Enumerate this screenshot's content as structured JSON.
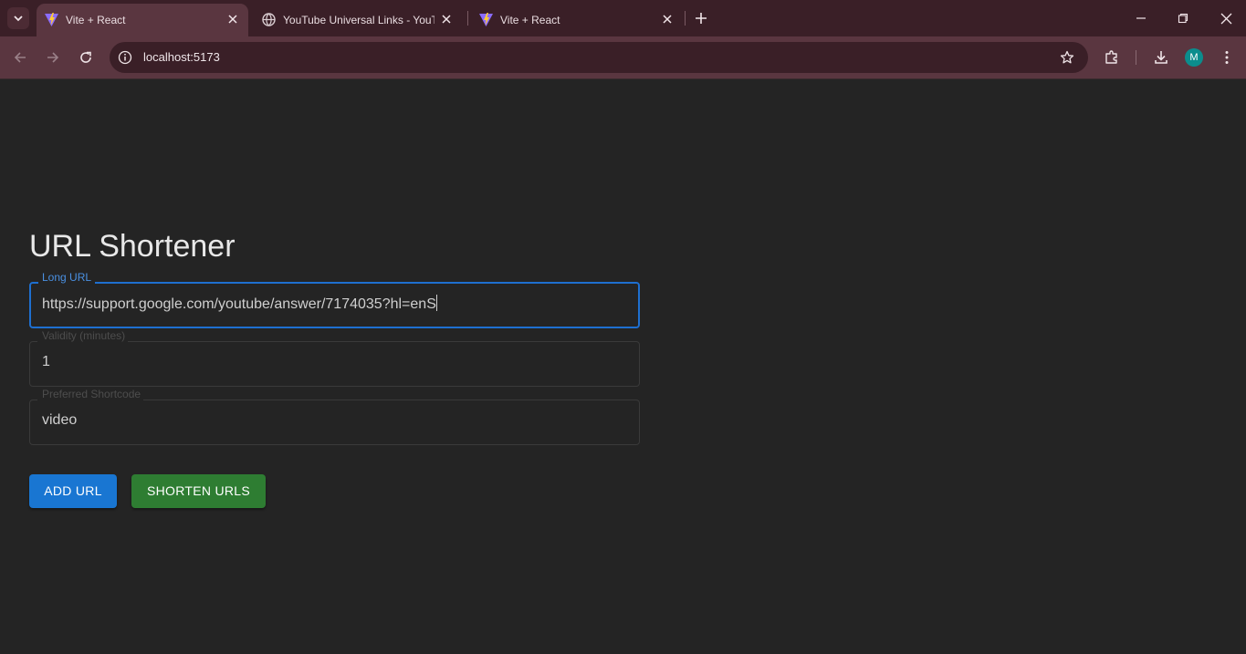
{
  "browser": {
    "tabs": [
      {
        "title": "Vite + React",
        "active": true,
        "favicon": "vite-icon"
      },
      {
        "title": "YouTube Universal Links - YouTube",
        "active": false,
        "favicon": "globe-icon"
      },
      {
        "title": "Vite + React",
        "active": false,
        "favicon": "vite-icon"
      }
    ],
    "address": "localhost:5173",
    "profile_initial": "M",
    "colors": {
      "frame": "#3a1f27",
      "toolbar": "#5a3640",
      "avatar": "#0b8d8d"
    }
  },
  "page": {
    "title": "URL Shortener",
    "fields": [
      {
        "label": "Long URL",
        "value": "https://support.google.com/youtube/answer/7174035?hl=enS",
        "focused": true
      },
      {
        "label": "Validity (minutes)",
        "value": "1",
        "focused": false
      },
      {
        "label": "Preferred Shortcode",
        "value": "video",
        "focused": false
      }
    ],
    "buttons": {
      "add_url": "ADD URL",
      "shorten_urls": "SHORTEN URLS"
    },
    "colors": {
      "background": "#242424",
      "primary": "#1976d2",
      "success": "#2e7d32",
      "focus": "#1e6fd0"
    }
  }
}
